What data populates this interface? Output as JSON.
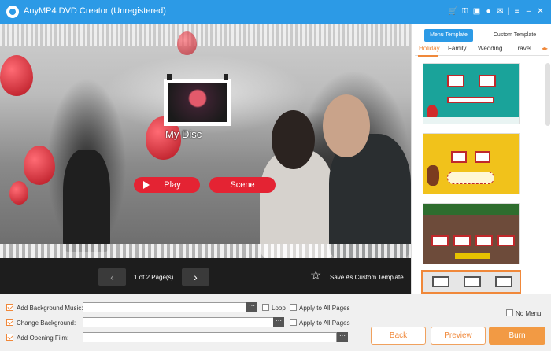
{
  "window": {
    "title": "AnyMP4 DVD Creator (Unregistered)",
    "icons": [
      "cart-icon",
      "key-icon",
      "save-icon",
      "user-icon",
      "feedback-icon",
      "menu-icon",
      "minimize-icon",
      "close-icon"
    ]
  },
  "preview": {
    "disc_title": "My Disc",
    "play_label": "Play",
    "scene_label": "Scene"
  },
  "pager": {
    "prev_label": "‹",
    "next_label": "›",
    "page_text": "1 of 2 Page(s)",
    "save_template_label": "Save As Custom Template"
  },
  "template_panel": {
    "tabs": [
      "Menu Template",
      "Custom Template"
    ],
    "active_tab": "Menu Template",
    "categories": [
      "Holiday",
      "Family",
      "Wedding",
      "Travel"
    ],
    "active_category": "Holiday",
    "more_arrows": "◂▸"
  },
  "bottom": {
    "add_music_label": "Add Background Music:",
    "add_music_value": "",
    "change_bg_label": "Change Background:",
    "change_bg_value": "",
    "add_film_label": "Add Opening Film:",
    "add_film_value": "",
    "loop_label": "Loop",
    "apply_all_label_1": "Apply to All Pages",
    "apply_all_label_2": "Apply to All Pages",
    "no_menu_label": "No Menu",
    "browse_label": "···",
    "back_label": "Back",
    "preview_label": "Preview",
    "burn_label": "Burn"
  },
  "colors": {
    "titlebar": "#2c9ae6",
    "accent": "#f0883a",
    "button_red": "#e42333"
  }
}
